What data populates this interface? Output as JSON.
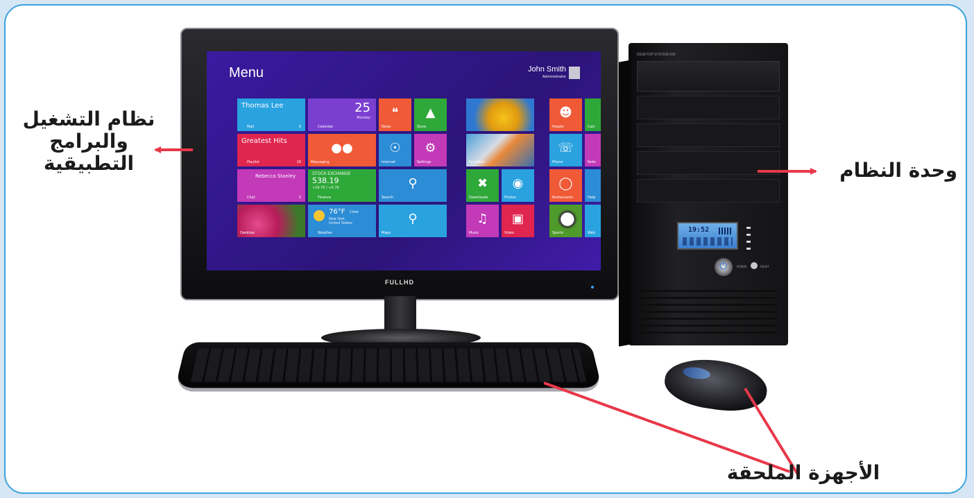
{
  "labels": {
    "os_line1": "نظام التشغيل",
    "os_line2": "والبرامج",
    "os_line3": "التطبيقية",
    "system_unit": "وحدة النظام",
    "peripherals": "الأجهزة الملحقة"
  },
  "colors": {
    "frame": "#3aa4dc",
    "arrow": "#e8384a",
    "screen_bg": "#3d1a9e"
  },
  "monitor": {
    "brand": "FULLHD",
    "screen": {
      "menu_title": "Menu",
      "user_name": "John Smith",
      "user_role": "Administrator",
      "tiles": {
        "mail": {
          "title": "Thomas Lee",
          "label": "Mail",
          "count": "9"
        },
        "calendar": {
          "day": "25",
          "weekday": "Monday",
          "label": "Calendar"
        },
        "news": "News",
        "store": "Store",
        "music_hits": {
          "title": "Greatest Hits",
          "label": "Playlist",
          "count": "16"
        },
        "messaging": "Messaging",
        "internet": "Internet",
        "settings": "Settings",
        "chat": {
          "title": "Rebecca Stanley",
          "label": "Chat",
          "count": "5"
        },
        "finance": {
          "title": "STOCK EXCHANGE",
          "value": "538.19",
          "change": "+29.76 / +4.78",
          "label": "Finance"
        },
        "search": "Search",
        "desktop": "Desktop",
        "weather": {
          "temp": "76°F",
          "cond": "Clear",
          "city": "New York",
          "country": "United States",
          "label": "Weather"
        },
        "maps": "Maps",
        "favorites": "Favorites",
        "downloads": "Downloads",
        "photos": "Photos",
        "music": "Music",
        "video": "Video",
        "people": "People",
        "phone": "Phone",
        "restaurants": "Restaurants",
        "sports": "Sports",
        "calc": "Calc",
        "notes": "Note",
        "help": "Help",
        "web": "Web"
      }
    }
  },
  "tower": {
    "model": "DESKTOP SYSTEM 500",
    "lcd_time": "19:52",
    "power_label": "POWER",
    "reset_label": "RESET"
  }
}
